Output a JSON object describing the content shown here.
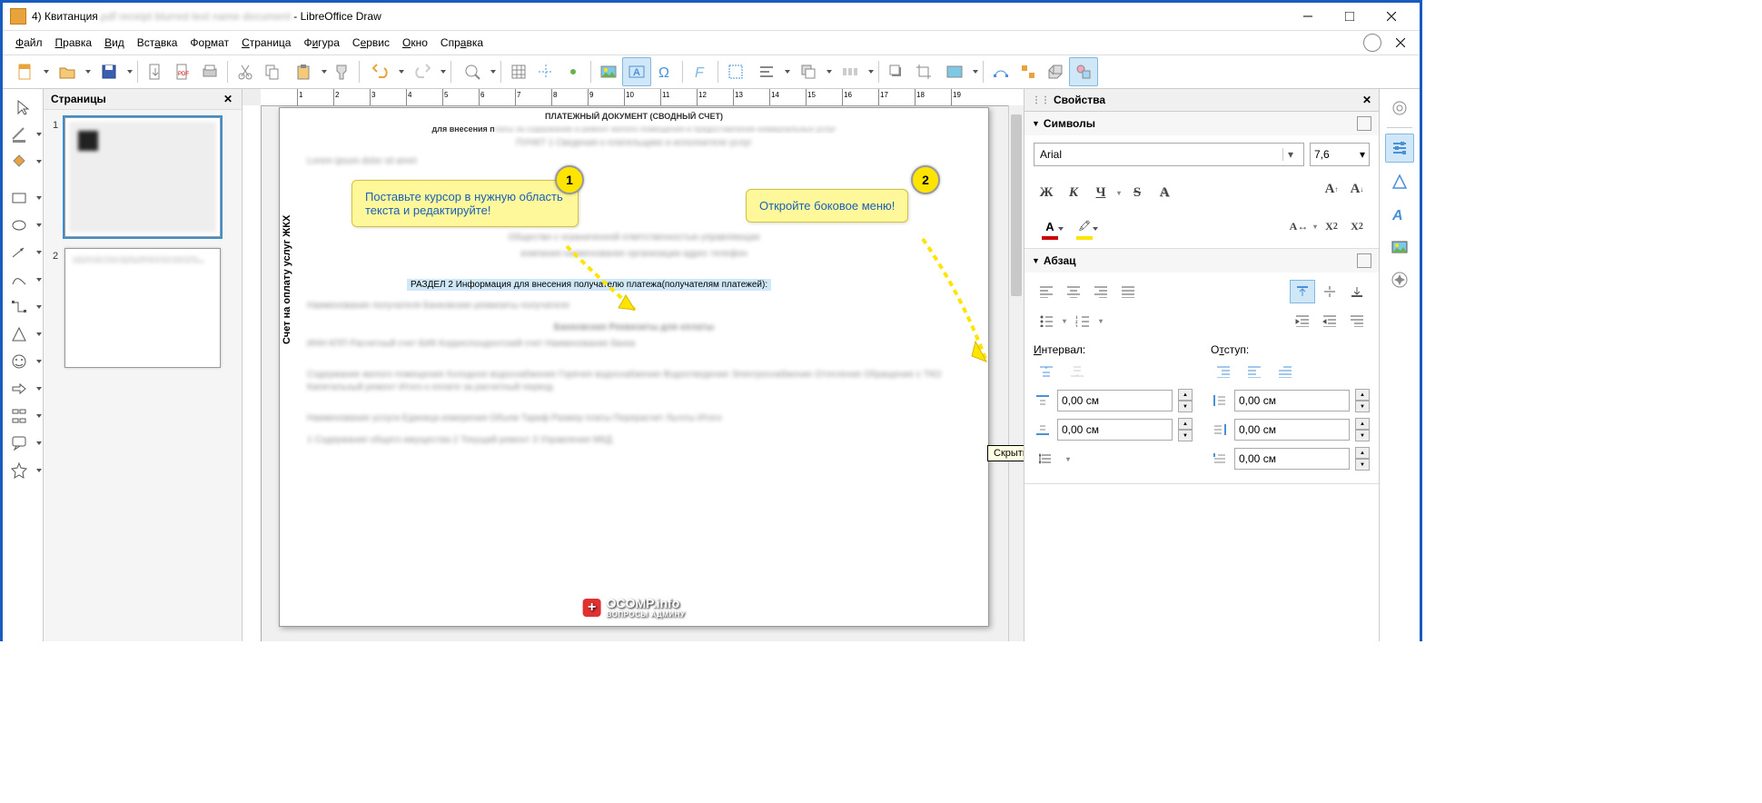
{
  "window": {
    "doc_prefix": "4) Квитанция",
    "app_name": "LibreOffice Draw"
  },
  "menu": {
    "items": [
      "Файл",
      "Правка",
      "Вид",
      "Вставка",
      "Формат",
      "Страница",
      "Фигура",
      "Сервис",
      "Окно",
      "Справка"
    ]
  },
  "pages_panel": {
    "title": "Страницы",
    "thumbs": [
      {
        "num": "1"
      },
      {
        "num": "2"
      }
    ]
  },
  "document": {
    "vertical_label": "Счет на оплату услуг ЖКХ",
    "header_line1": "ПЛАТЕЖНЫЙ ДОКУМЕНТ (СВОДНЫЙ СЧЕТ)",
    "header_line2": "для внесения п",
    "executor_label": "нителя(ей) услуг:",
    "highlighted_text": "РАЗДЕЛ 2 Информация для внесения получателю платежа(получателям платежей):"
  },
  "callouts": {
    "c1": {
      "num": "1",
      "text": "Поставьте курсор в нужную область текста и редактируйте!"
    },
    "c2": {
      "num": "2",
      "text": "Откройте боковое меню!"
    }
  },
  "tooltip": {
    "text": "Скрыть"
  },
  "props": {
    "panel_title": "Свойства",
    "section_chars": "Символы",
    "section_para": "Абзац",
    "font_name": "Arial",
    "font_size": "7,6",
    "bold": "Ж",
    "italic": "К",
    "underline": "Ч",
    "strike": "S",
    "shadow": "A",
    "interval_label": "Интервал:",
    "indent_label": "Отступ:",
    "zero_cm": "0,00 см"
  },
  "watermark": {
    "text": "OCOMP.info",
    "sub": "ВОПРОСЫ АДМИНУ"
  }
}
